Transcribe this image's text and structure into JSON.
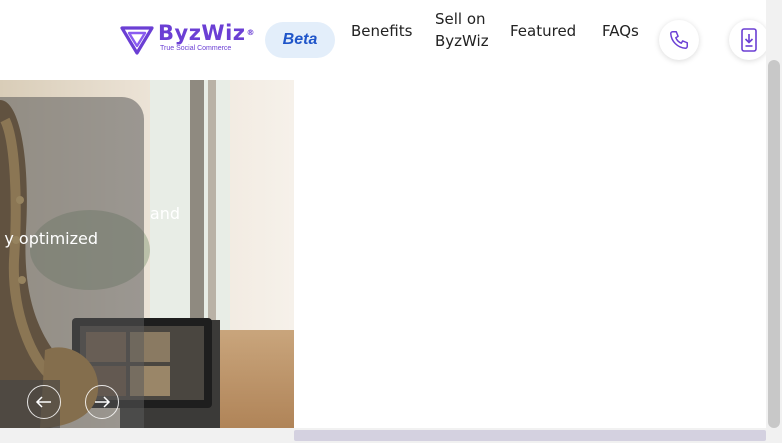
{
  "header": {
    "logo": {
      "name": "ByzWiz",
      "registered": "®",
      "tagline": "True Social Commerce"
    },
    "beta_label": "Beta",
    "nav": {
      "benefits": "Benefits",
      "sell_line1": "Sell on",
      "sell_line2": "ByzWiz",
      "featured": "Featured",
      "faqs": "FAQs"
    },
    "icons": {
      "phone": "phone-icon",
      "app": "mobile-download-icon"
    }
  },
  "hero": {
    "caption_line1": "and",
    "caption_line2": "y optimized",
    "prev_icon": "arrow-left-icon",
    "next_icon": "arrow-right-icon"
  },
  "colors": {
    "brand": "#6b3fd4",
    "beta_bg": "#e3eefa",
    "beta_text": "#1f55c9"
  }
}
